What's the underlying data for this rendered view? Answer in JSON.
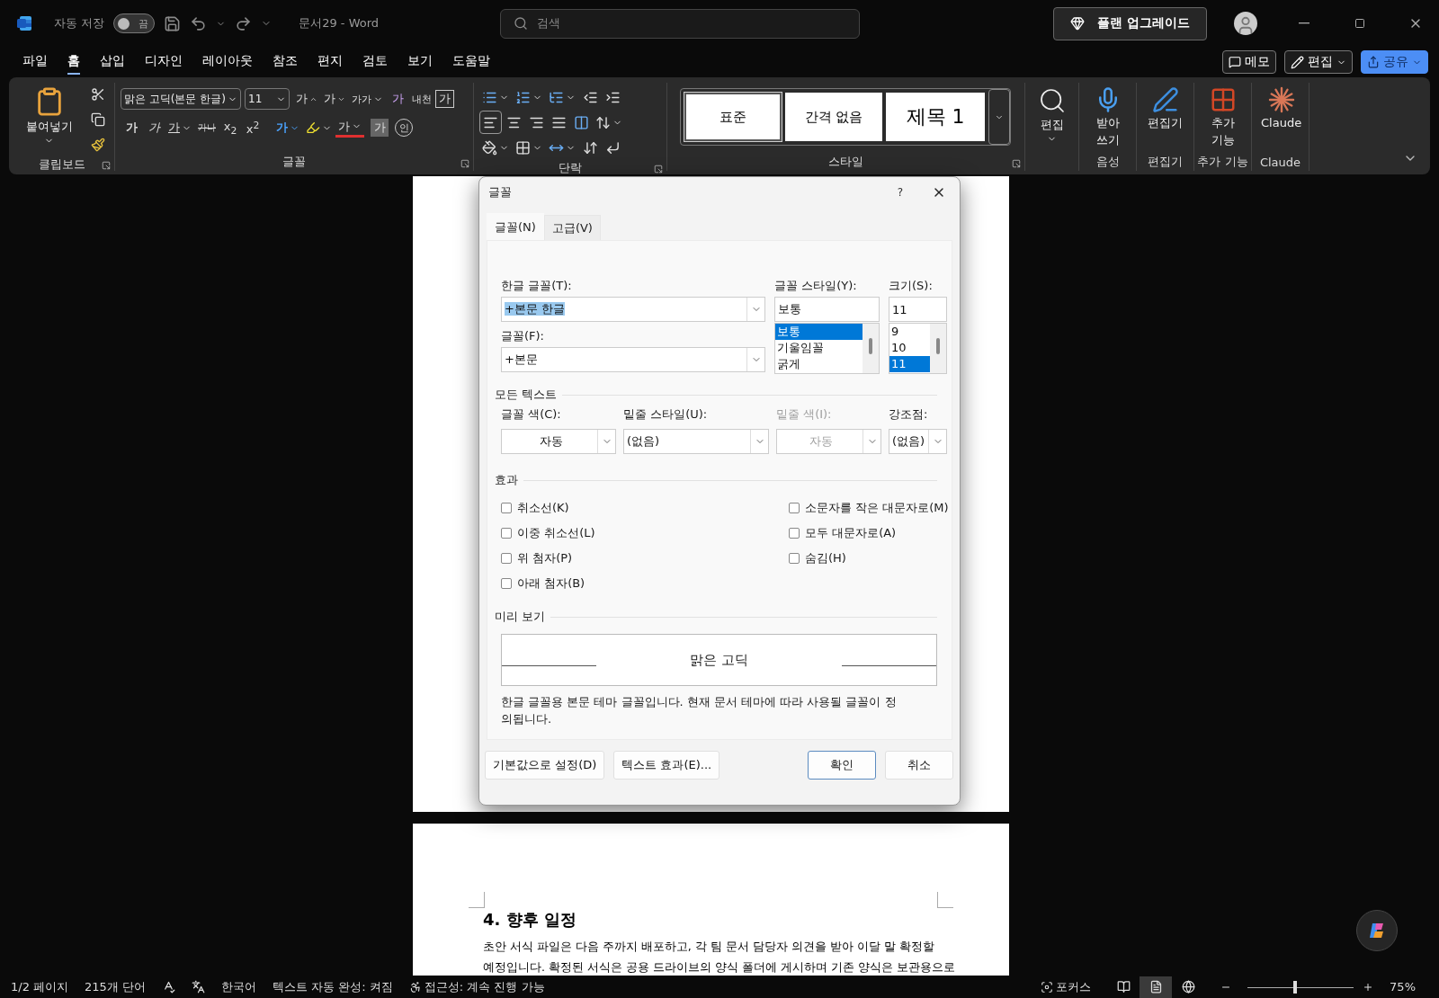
{
  "title_bar": {
    "autosave_label": "자동 저장",
    "autosave": {
      "on": false,
      "label": "끔"
    },
    "document_title": "문서29  -  Word",
    "search_placeholder": "검색",
    "upgrade_button": "플랜 업그레이드"
  },
  "menu_tabs": [
    {
      "label": "파일",
      "selected": false
    },
    {
      "label": "홈",
      "selected": true
    },
    {
      "label": "삽입",
      "selected": false
    },
    {
      "label": "디자인",
      "selected": false
    },
    {
      "label": "레이아웃",
      "selected": false
    },
    {
      "label": "참조",
      "selected": false
    },
    {
      "label": "편지",
      "selected": false
    },
    {
      "label": "검토",
      "selected": false
    },
    {
      "label": "보기",
      "selected": false
    },
    {
      "label": "도움말",
      "selected": false
    }
  ],
  "ribbon_actions": {
    "comments": "메모",
    "editing_mode": "편집",
    "share": "공유"
  },
  "ribbon": {
    "clipboard": {
      "paste": "붙여넣기",
      "label": "클립보드"
    },
    "font": {
      "font_name": "맑은 고딕(본문 한글)",
      "font_size": "11",
      "grow": "가",
      "shrink": "가",
      "change_case": "가가",
      "clear_format": "가",
      "phonetic_guide": "내천",
      "character_border": "가",
      "bold": "가",
      "italic": "가",
      "underline": "가",
      "strikethrough": "가나",
      "subscript": "x$_{2}$",
      "superscript": "x$^{2}$",
      "text_effects": "가",
      "font_color": "가",
      "character_shading": "가",
      "enclose_characters": "인",
      "label": "글꼴"
    },
    "paragraph": {
      "label": "단락"
    },
    "styles": {
      "items": [
        {
          "label": "표준",
          "selected": true
        },
        {
          "label": "간격 없음",
          "selected": false
        },
        {
          "label": "제목 1",
          "selected": false
        }
      ],
      "label": "스타일"
    },
    "editing": {
      "button": "편집"
    },
    "voice": {
      "button_lines": [
        "받아",
        "쓰기"
      ],
      "label": "음성"
    },
    "editor": {
      "button": "편집기",
      "label": "편집기"
    },
    "add_ins": {
      "button_lines": [
        "추가",
        "기능"
      ],
      "label": "추가 기능"
    },
    "claude": {
      "button": "Claude",
      "label": "Claude"
    }
  },
  "document": {
    "heading": "4. 향후 일정",
    "body_lines": [
      "초안 서식 파일은 다음 주까지 배포하고, 각 팀 문서 담당자 의견을 받아 이달 말 확정할",
      "예정입니다. 확정된 서식은 공용 드라이브의 양식 폴더에 게시하며 기존 양식은 보관용으로"
    ]
  },
  "dialog": {
    "title": "글꼴",
    "help": "?",
    "tabs": [
      {
        "label": "글꼴(N)",
        "selected": true
      },
      {
        "label": "고급(V)",
        "selected": false
      }
    ],
    "hangul_font": {
      "label": "한글 글꼴(T):",
      "value": "+본문 한글",
      "highlighted": true
    },
    "font": {
      "label": "글꼴(F):",
      "value": "+본문",
      "highlighted": false
    },
    "style": {
      "label": "글꼴 스타일(Y):",
      "value": "보통",
      "options": [
        {
          "label": "보통",
          "selected": true
        },
        {
          "label": "기울임꼴",
          "selected": false
        },
        {
          "label": "굵게",
          "selected": false
        }
      ]
    },
    "size": {
      "label": "크기(S):",
      "value": "11",
      "options": [
        {
          "label": "9",
          "selected": false
        },
        {
          "label": "10",
          "selected": false
        },
        {
          "label": "11",
          "selected": true
        }
      ]
    },
    "all_text": {
      "heading": "모든 텍스트",
      "fields": [
        {
          "kind": "color",
          "label": "글꼴 색(C):",
          "value": "자동",
          "disabled": false
        },
        {
          "kind": "list",
          "label": "밑줄 스타일(U):",
          "value": "(없음)",
          "disabled": false
        },
        {
          "kind": "color",
          "label": "밑줄 색(I):",
          "value": "자동",
          "disabled": true
        },
        {
          "kind": "list",
          "label": "강조점:",
          "value": "(없음)",
          "disabled": false
        }
      ]
    },
    "effects": {
      "heading": "효과",
      "left": [
        {
          "label": "취소선(K)",
          "checked": false
        },
        {
          "label": "이중 취소선(L)",
          "checked": false
        },
        {
          "label": "위 첨자(P)",
          "checked": false
        },
        {
          "label": "아래 첨자(B)",
          "checked": false
        }
      ],
      "right": [
        {
          "label": "소문자를 작은 대문자로(M)",
          "checked": false
        },
        {
          "label": "모두 대문자로(A)",
          "checked": false
        },
        {
          "label": "숨김(H)",
          "checked": false
        }
      ]
    },
    "preview": {
      "heading": "미리 보기",
      "sample": "맑은 고딕",
      "description": "한글 글꼴용 본문 테마 글꼴입니다. 현재 문서 테마에 따라 사용될 글꼴이 정의됩니다."
    },
    "buttons": [
      {
        "label": "기본값으로 설정(D)",
        "default": false
      },
      {
        "label": "텍스트 효과(E)...",
        "default": false
      },
      {
        "label": "확인",
        "default": true
      },
      {
        "label": "취소",
        "default": false
      }
    ]
  },
  "status_bar": {
    "page": "1/2 페이지",
    "words": "215개 단어",
    "language": "한국어",
    "text_predictions": "텍스트 자동 완성: 켜짐",
    "accessibility": "접근성: 계속 진행 가능",
    "focus": "포커스",
    "views": [
      {
        "kind": "read",
        "selected": false
      },
      {
        "kind": "print",
        "selected": true
      },
      {
        "kind": "web",
        "selected": false
      }
    ],
    "zoom": {
      "level": 0.45,
      "reading": "75%"
    }
  }
}
